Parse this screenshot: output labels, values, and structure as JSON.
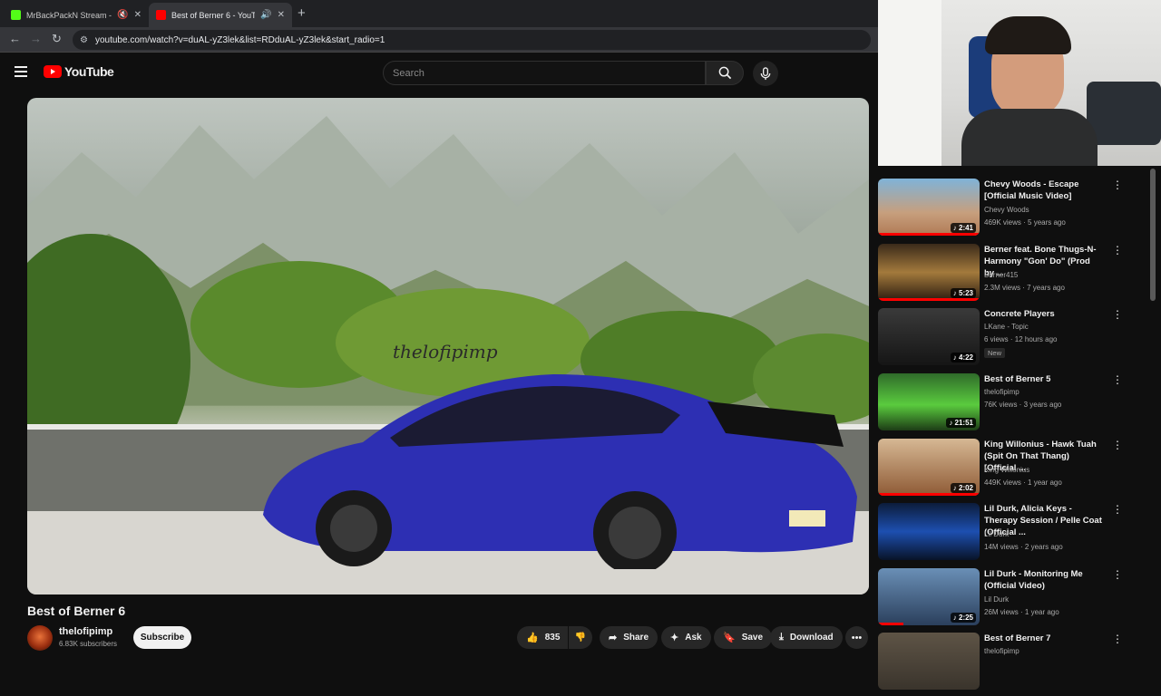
{
  "browser": {
    "tabs": [
      {
        "title": "MrBackPackN Stream - Wa",
        "favicon_color": "#53fc18",
        "active": false
      },
      {
        "title": "Best of Berner 6 - YouTube",
        "favicon_color": "#ff0000",
        "active": true
      }
    ],
    "new_tab_label": "+",
    "url": "youtube.com/watch?v=duAL-yZ3lek&list=RDduAL-yZ3lek&start_radio=1"
  },
  "header": {
    "logo_text": "YouTube",
    "search_placeholder": "Search"
  },
  "video": {
    "watermark": "thelofipimp",
    "title": "Best of Berner 6",
    "channel": "thelofipimp",
    "subscribers": "6.83K subscribers",
    "subscribe_label": "Subscribe",
    "likes": "835",
    "share_label": "Share",
    "ask_label": "Ask",
    "save_label": "Save",
    "download_label": "Download"
  },
  "recommendations": [
    {
      "title": "Chevy Woods - Escape [Official Music Video]",
      "channel": "Chevy Woods",
      "meta": "469K views · 5 years ago",
      "duration": "2:41",
      "watched": 1.0
    },
    {
      "title": "Berner feat. Bone Thugs-N-Harmony \"Gon' Do\" (Prod by ...",
      "channel": "Berner415",
      "meta": "2.3M views · 7 years ago",
      "duration": "5:23",
      "watched": 1.0
    },
    {
      "title": "Concrete Players",
      "channel": "LKane - Topic",
      "meta": "6 views · 12 hours ago",
      "duration": "4:22",
      "badge": "New",
      "watched": 0
    },
    {
      "title": "Best of Berner 5",
      "channel": "thelofipimp",
      "meta": "76K views · 3 years ago",
      "duration": "21:51",
      "watched": 0
    },
    {
      "title": "King Willonius - Hawk Tuah (Spit On That Thang) [Official ...",
      "channel": "King Willonius",
      "meta": "449K views · 1 year ago",
      "duration": "2:02",
      "watched": 1.0
    },
    {
      "title": "Lil Durk, Alicia Keys - Therapy Session / Pelle Coat (Official ...",
      "channel": "Lil Durk",
      "meta": "14M views · 2 years ago",
      "duration": "",
      "watched": 0
    },
    {
      "title": "Lil Durk - Monitoring Me (Official Video)",
      "channel": "Lil Durk",
      "meta": "26M views · 1 year ago",
      "duration": "2:25",
      "watched": 0.25
    },
    {
      "title": "Best of Berner 7",
      "channel": "thelofipimp",
      "meta": "",
      "duration": "",
      "watched": 0
    }
  ]
}
